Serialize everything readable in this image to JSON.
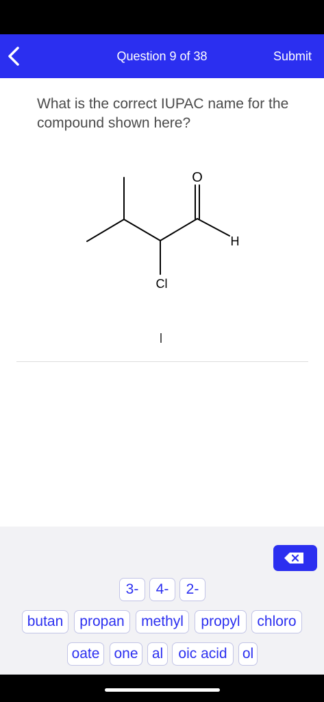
{
  "header": {
    "title": "Question 9 of 38",
    "submit_label": "Submit"
  },
  "question": {
    "text": "What is the correct IUPAC name for the compound shown here?"
  },
  "molecule": {
    "atoms": {
      "oxygen": "O",
      "hydrogen": "H",
      "chlorine": "Cl"
    }
  },
  "answer": {
    "value": ""
  },
  "keyboard": {
    "locants": [
      "3-",
      "4-",
      "2-"
    ],
    "roots": [
      "butan",
      "propan",
      "methyl",
      "propyl",
      "chloro"
    ],
    "suffixes": [
      "oate",
      "one",
      "al",
      "oic acid",
      "ol"
    ]
  },
  "colors": {
    "accent": "#2b2ff0",
    "question_text": "#4a4a4a",
    "keyboard_bg": "#f2f2f5"
  }
}
